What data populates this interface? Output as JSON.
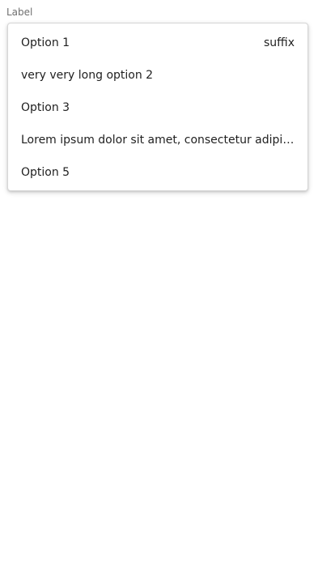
{
  "field": {
    "label": "Label"
  },
  "menu": {
    "options": [
      {
        "label": "Option 1",
        "suffix": "suffix"
      },
      {
        "label": "very very long option 2"
      },
      {
        "label": "Option 3"
      },
      {
        "label": "Lorem ipsum dolor sit amet, consectetur adipisicing elit"
      },
      {
        "label": "Option 5"
      }
    ]
  }
}
